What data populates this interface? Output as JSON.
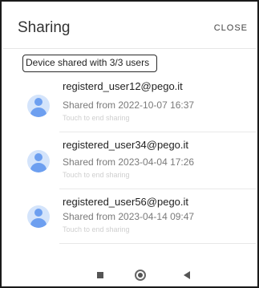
{
  "header": {
    "title": "Sharing",
    "close_label": "CLOSE"
  },
  "badge": {
    "text": "Device shared with 3/3 users"
  },
  "users": [
    {
      "email": "registerd_user12@pego.it",
      "shared": "Shared from 2022-10-07 16:37",
      "hint": "Touch to end sharing"
    },
    {
      "email": "registered_user34@pego.it",
      "shared": "Shared from 2023-04-04 17:26",
      "hint": "Touch to end sharing"
    },
    {
      "email": "registered_user56@pego.it",
      "shared": "Shared from 2023-04-14 09:47",
      "hint": "Touch to end sharing"
    }
  ],
  "icons": {
    "avatar": "user-avatar-icon",
    "recents": "square-recents-icon",
    "home": "circle-home-icon",
    "back": "triangle-back-icon"
  },
  "colors": {
    "avatar_bg": "#d4e4fb",
    "avatar_fg": "#6d9ff0"
  }
}
